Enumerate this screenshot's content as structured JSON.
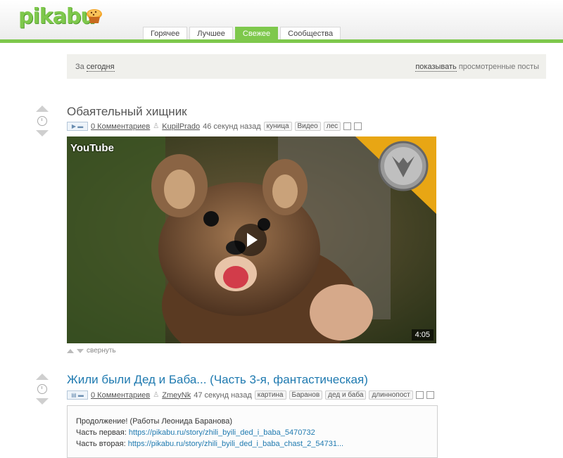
{
  "header": {
    "logo_text": "pikabu",
    "tabs": [
      {
        "label": "Горячее",
        "active": false
      },
      {
        "label": "Лучшее",
        "active": false
      },
      {
        "label": "Свежее",
        "active": true
      },
      {
        "label": "Сообщества",
        "active": false
      }
    ],
    "accent_color": "#7ec84c"
  },
  "filter": {
    "prefix": "За",
    "period": "сегодня",
    "show_link": "показывать",
    "show_rest": "просмотренные посты"
  },
  "posts": [
    {
      "title": "Обаятельный хищник",
      "type_icon": "video-icon",
      "comments": "0 Комментариев",
      "author": "KupilPrado",
      "time": "46 секунд назад",
      "tags": [
        "куница",
        "Видео",
        "лес"
      ],
      "video": {
        "provider": "YouTube",
        "duration": "4:05"
      },
      "collapse_label": "свернуть"
    },
    {
      "title": "Жили были Дед и Баба... (Часть 3-я, фантастическая)",
      "type_icon": "text-icon",
      "comments": "0 Комментариев",
      "author": "ZmeyNk",
      "time": "47 секунд назад",
      "tags": [
        "картина",
        "Баранов",
        "дед и баба",
        "длиннопост"
      ],
      "text": {
        "line1": "Продолжение! (Работы Леонида Баранова)",
        "line2_label": "Часть первая:",
        "line2_link": "https://pikabu.ru/story/zhili_byili_ded_i_baba_5470732",
        "line3_label": "Часть вторая:",
        "line3_link": "https://pikabu.ru/story/zhili_byili_ded_i_baba_chast_2_54731..."
      }
    }
  ]
}
